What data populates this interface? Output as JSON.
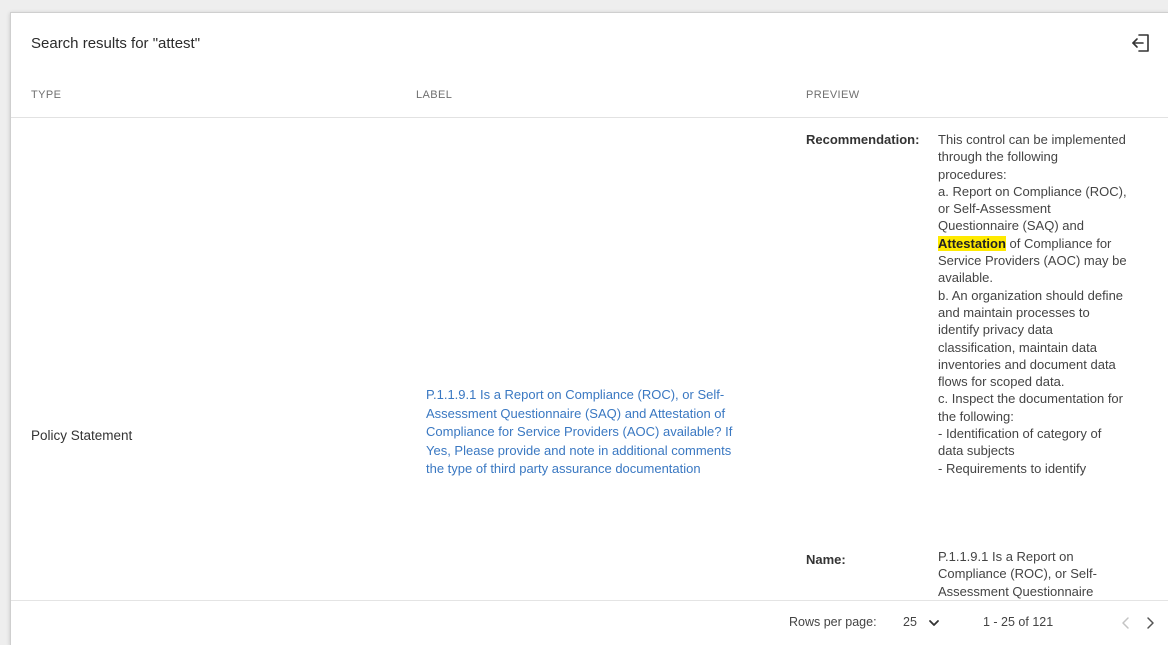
{
  "dialog": {
    "title": "Search results for \"attest\"",
    "close_icon": "exit-icon"
  },
  "columns": {
    "type": "TYPE",
    "label": "LABEL",
    "preview": "PREVIEW"
  },
  "row": {
    "type": "Policy Statement",
    "label_lines": [
      "P.1.1.9.1 Is a Report on Compliance (ROC), or Self-",
      "Assessment Questionnaire (SAQ) and Attestation of",
      "Compliance for Service Providers (AOC) available? If",
      "Yes, Please provide and note in additional comments",
      "the type of third party assurance documentation"
    ],
    "preview": {
      "recommendation_key": "Recommendation:",
      "recommendation_lines": [
        "This control can be implemented",
        "through the following",
        "procedures:",
        "a. Report on Compliance (ROC),",
        "or Self-Assessment",
        "Questionnaire (SAQ) and",
        "",
        "Service Providers (AOC) may be",
        "available.",
        "b. An organization should define",
        "and maintain processes to",
        "identify privacy data",
        "classification, maintain data",
        "inventories and document data",
        "flows for scoped data.",
        "c. Inspect the documentation for",
        "the following:",
        "- Identification of category of",
        "data subjects",
        "- Requirements to identify"
      ],
      "highlight_term": "Attestation",
      "highlight_rest": " of Compliance for",
      "highlight_color": "#ffea00",
      "name_key": "Name:",
      "name_lines": [
        "P.1.1.9.1 Is a Report on",
        "Compliance (ROC), or Self-",
        "Assessment Questionnaire"
      ]
    }
  },
  "pagination": {
    "rows_per_page_label": "Rows per page:",
    "rows_per_page_value": "25",
    "range": "1 - 25 of 121",
    "prev_icon": "chevron-left-icon",
    "next_icon": "chevron-right-icon"
  },
  "colors": {
    "link": "#3a78c2",
    "highlight": "#ffea00"
  }
}
